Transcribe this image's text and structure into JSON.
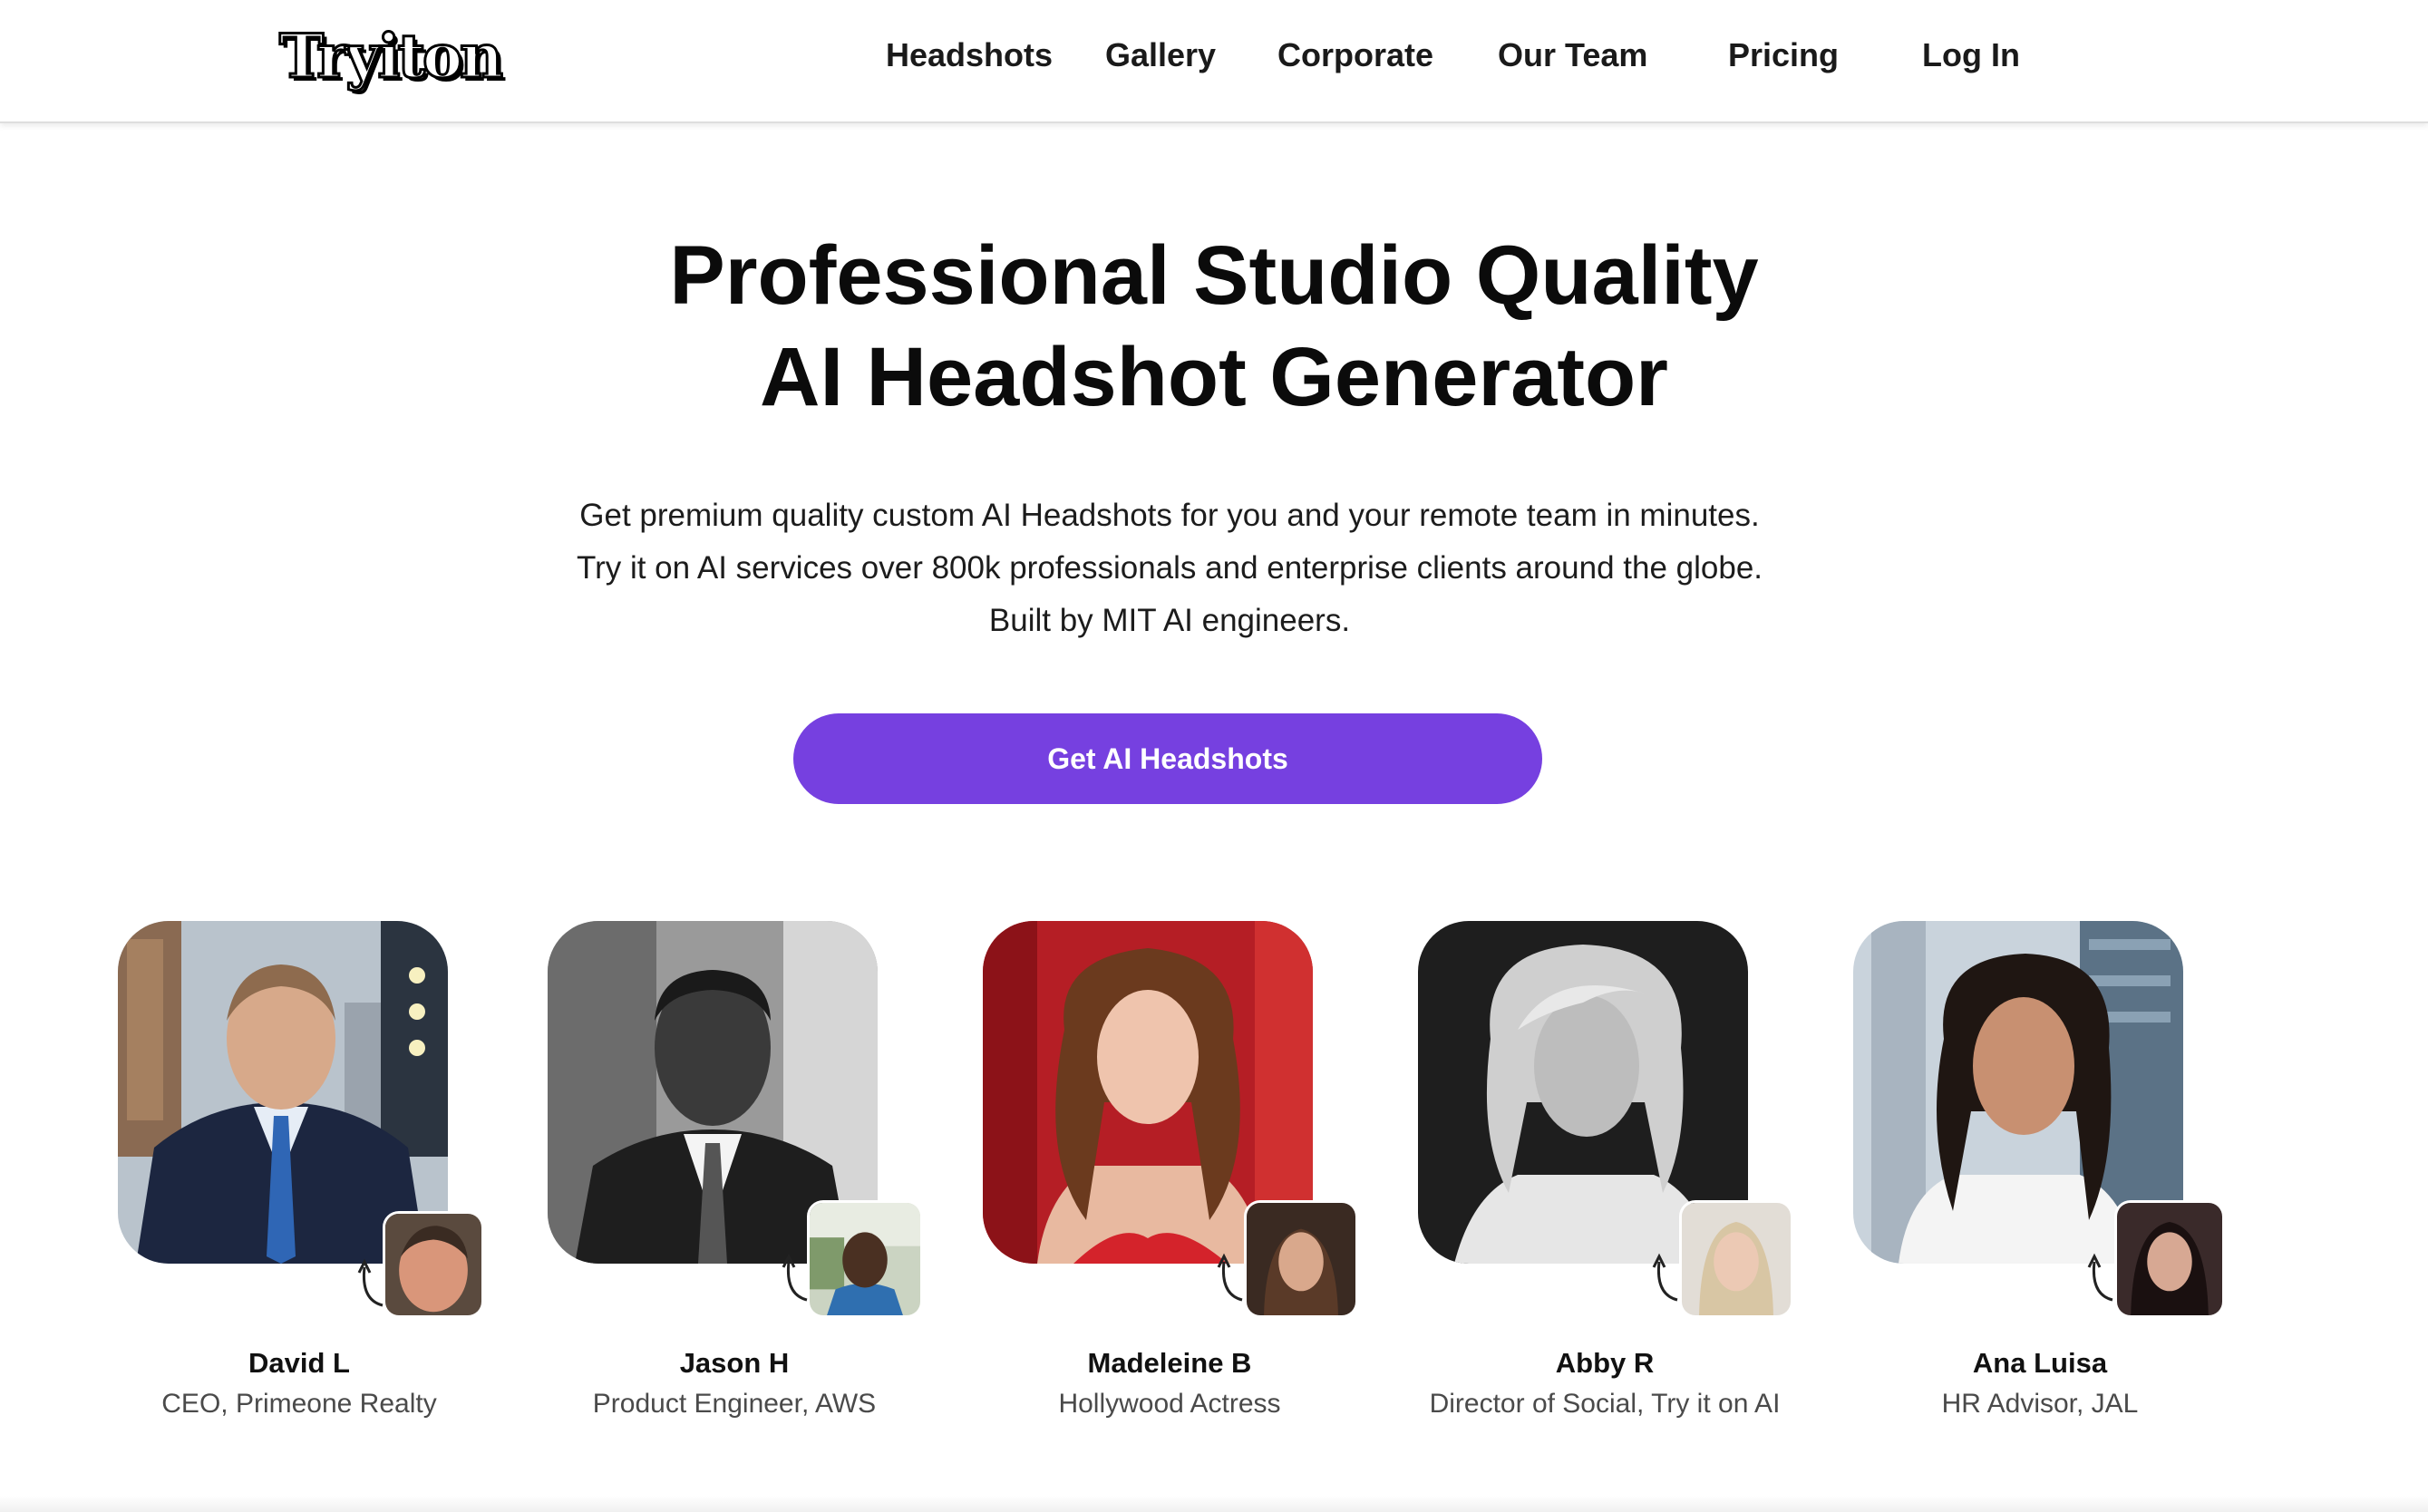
{
  "brand": {
    "logo_text": "Tryiton"
  },
  "nav": {
    "links": [
      "Headshots",
      "Gallery",
      "Corporate",
      "Our Team",
      "Pricing"
    ],
    "login_label": "Log In"
  },
  "hero": {
    "title_line1": "Professional Studio Quality",
    "title_line2": "AI Headshot Generator",
    "description": "Get premium quality custom AI Headshots for you and your remote team in minutes. Try it on AI services over 800k professionals and enterprise clients around the globe. Built by MIT AI engineers.",
    "cta_label": "Get AI Headshots",
    "cta_color": "#7640e0"
  },
  "testimonials": [
    {
      "name": "David L",
      "role": "CEO, Primeone Realty"
    },
    {
      "name": "Jason H",
      "role": "Product Engineer, AWS"
    },
    {
      "name": "Madeleine B",
      "role": "Hollywood Actress"
    },
    {
      "name": "Abby R",
      "role": "Director of Social, Try it on AI"
    },
    {
      "name": "Ana Luisa",
      "role": "HR Advisor, JAL"
    }
  ]
}
